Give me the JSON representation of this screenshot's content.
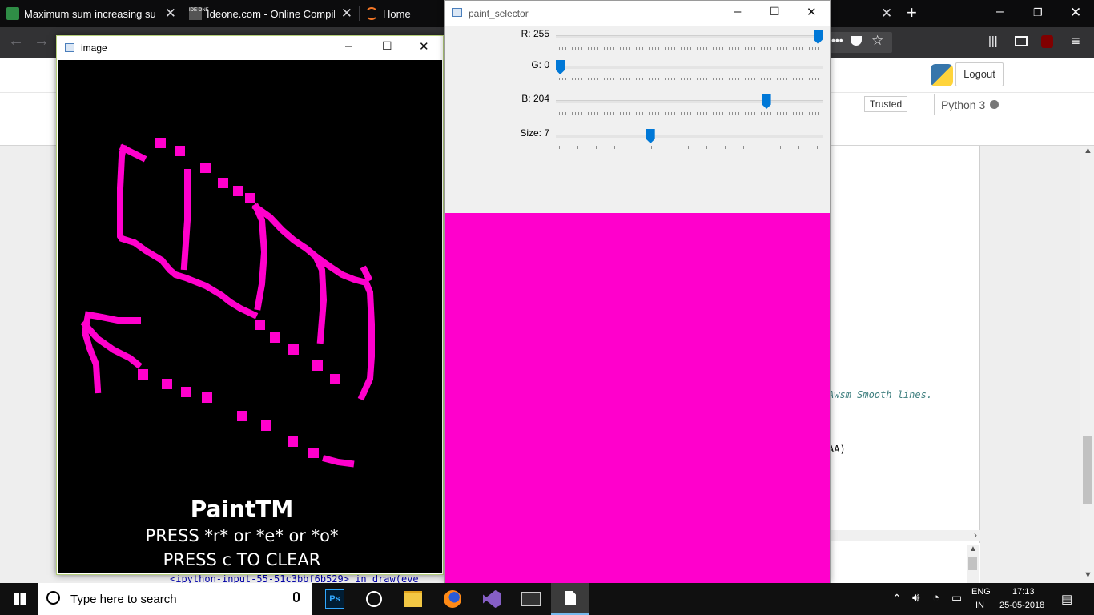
{
  "browser": {
    "tabs": [
      {
        "label": "Maximum sum increasing subs"
      },
      {
        "label": "Ideone.com - Online Compiler"
      },
      {
        "label": "Home"
      }
    ],
    "favicon_ideone_text": "IDE ONE"
  },
  "jupyter": {
    "logout_label": "Logout",
    "trusted_label": "Trusted",
    "kernel_label": "Python 3",
    "code_comment": "Awsm Smooth lines.",
    "code_fragment": "AA)",
    "traceback_line": "<ipython-input-55-51c3bbf6b529> in draw(eve"
  },
  "image_window": {
    "title": "image",
    "canvas_text": {
      "title": "PaintTM",
      "line1": "PRESS *r* or *e* or *o*",
      "line2": "PRESS c TO CLEAR"
    },
    "brush_color": "#ff00cc"
  },
  "paint_selector": {
    "title": "paint_selector",
    "sliders": [
      {
        "label": "R: 255",
        "value": 255,
        "max": 255
      },
      {
        "label": "G: 0",
        "value": 0,
        "max": 255
      },
      {
        "label": "B: 204",
        "value": 204,
        "max": 255
      },
      {
        "label": "Size: 7",
        "value": 7,
        "max": 20
      }
    ],
    "swatch_color": "#ff00cc"
  },
  "taskbar": {
    "search_placeholder": "Type here to search",
    "language": "ENG",
    "region": "IN",
    "time": "17:13",
    "date": "25-05-2018",
    "photoshop_label": "Ps"
  }
}
